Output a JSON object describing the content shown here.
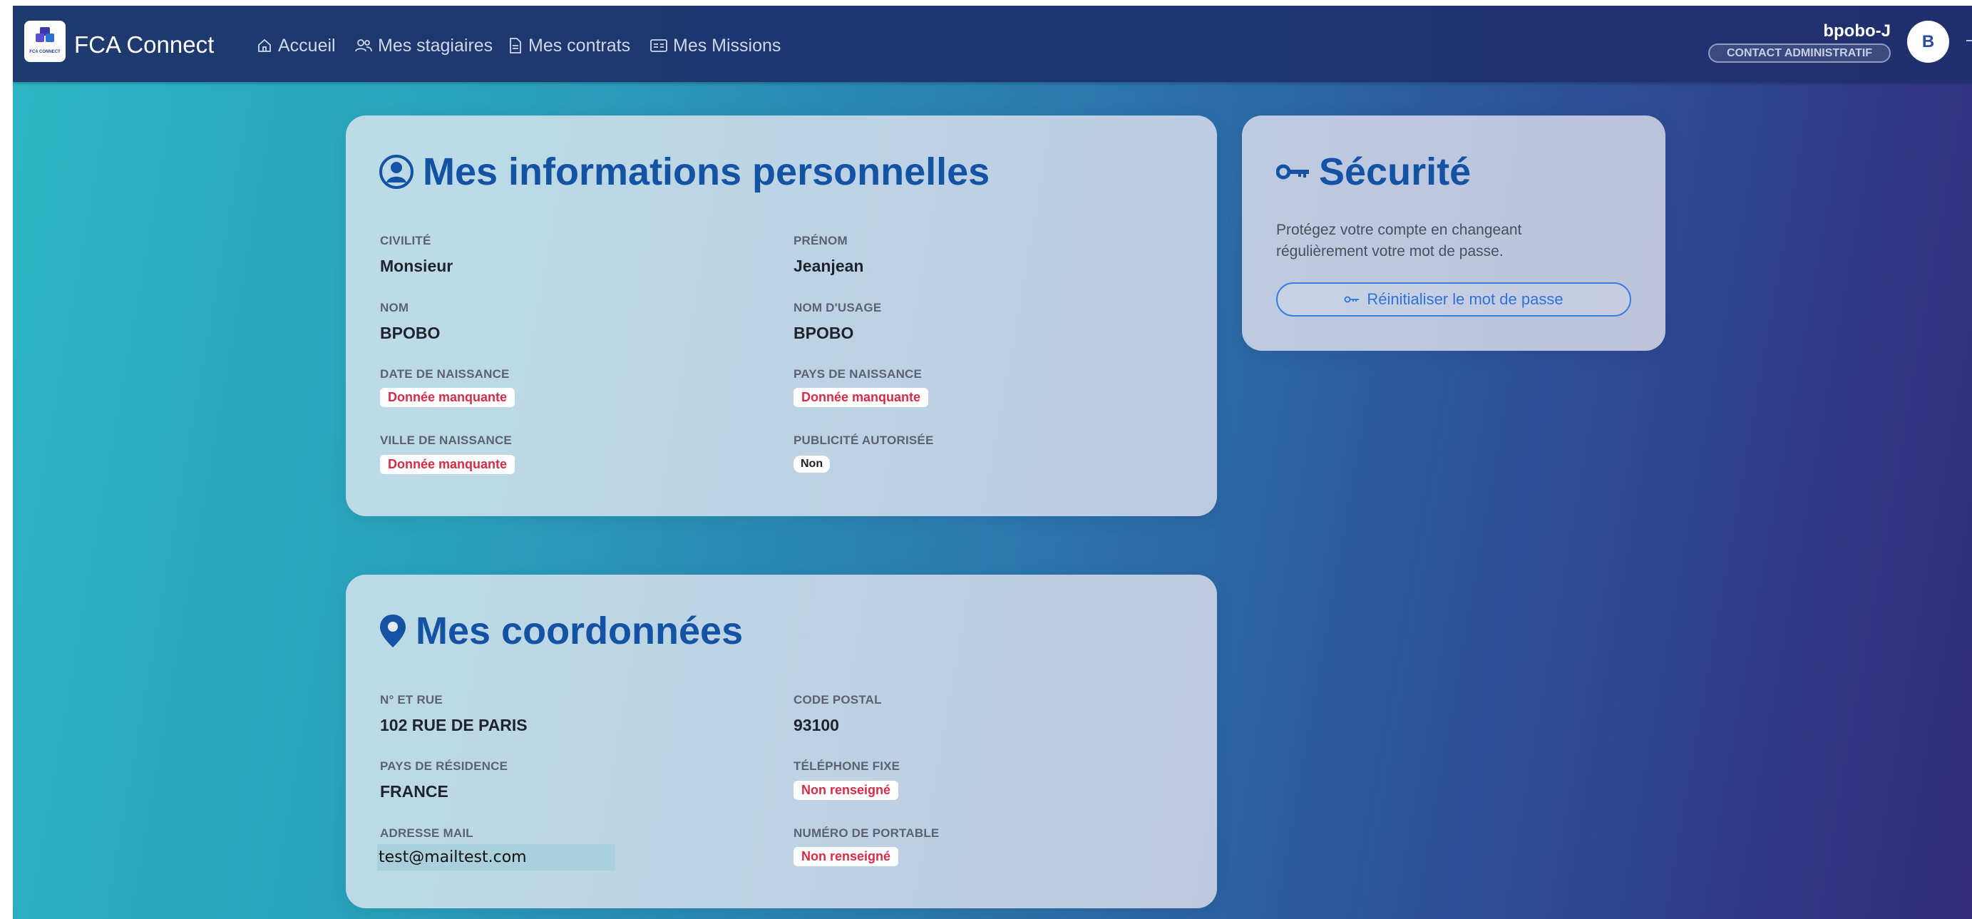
{
  "app": {
    "name": "FCA Connect",
    "logo_text": "FCA CONNECT"
  },
  "nav": [
    {
      "label": "Accueil",
      "icon": "home-icon"
    },
    {
      "label": "Mes stagiaires",
      "icon": "users-icon"
    },
    {
      "label": "Mes contrats",
      "icon": "document-icon"
    },
    {
      "label": "Mes Missions",
      "icon": "id-card-icon"
    }
  ],
  "user": {
    "name": "bpobo-J",
    "role": "CONTACT ADMINISTRATIF",
    "initial": "B"
  },
  "personal": {
    "title": "Mes informations personnelles",
    "civilite_label": "CIVILITÉ",
    "civilite": "Monsieur",
    "prenom_label": "PRÉNOM",
    "prenom": "Jeanjean",
    "nom_label": "NOM",
    "nom": "BPOBO",
    "nom_usage_label": "NOM D'USAGE",
    "nom_usage": "BPOBO",
    "date_naissance_label": "DATE DE NAISSANCE",
    "date_naissance": "Donnée manquante",
    "pays_naissance_label": "PAYS DE NAISSANCE",
    "pays_naissance": "Donnée manquante",
    "ville_naissance_label": "VILLE DE NAISSANCE",
    "ville_naissance": "Donnée manquante",
    "publicite_label": "PUBLICITÉ AUTORISÉE",
    "publicite": "Non"
  },
  "security": {
    "title": "Sécurité",
    "description": "Protégez votre compte en changeant régulièrement votre mot de passe.",
    "reset_label": "Réinitialiser le mot de passe"
  },
  "contact": {
    "title": "Mes coordonnées",
    "rue_label": "N° ET RUE",
    "rue": "102 RUE DE PARIS",
    "cp_label": "CODE POSTAL",
    "cp": "93100",
    "pays_label": "PAYS DE RÉSIDENCE",
    "pays": "FRANCE",
    "tel_fixe_label": "TÉLÉPHONE FIXE",
    "tel_fixe": "Non renseigné",
    "mail_label": "ADRESSE MAIL",
    "mail": "test@mailtest.com",
    "portable_label": "NUMÉRO DE PORTABLE",
    "portable": "Non renseigné"
  },
  "colors": {
    "title_blue": "#1452a3",
    "missing_red": "#d42d45",
    "accent": "#2f72d9"
  }
}
